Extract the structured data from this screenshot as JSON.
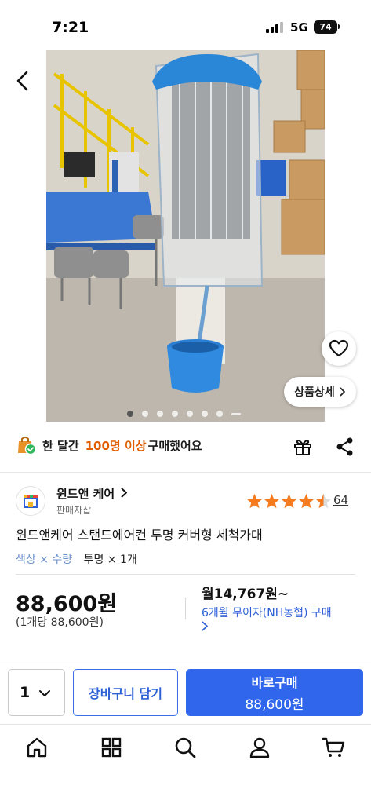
{
  "status": {
    "time": "7:21",
    "network": "5G",
    "battery": "74"
  },
  "photo": {
    "detail_label": "상품상세",
    "dot_count": 7,
    "active_dot": 0
  },
  "purchase_stat": {
    "prefix": "한 달간",
    "highlight": "100명 이상",
    "suffix": "구매했어요"
  },
  "seller": {
    "name": "윈드앤 케어",
    "type": "판매자삽",
    "rating": 4.5,
    "review_count": "64"
  },
  "product": {
    "title": "윈드앤케어 스탠드에어컨 투명 커버형 세척가대",
    "option_label": "색상 × 수량",
    "option_value": "투명 × 1개"
  },
  "price": {
    "total": "88,600원",
    "unit": "(1개당 88,600원)",
    "monthly": "월14,767원~",
    "installment": "6개월 무이자(NH농협) 구매"
  },
  "purchase_bar": {
    "quantity": "1",
    "cart_label": "장바구니 담기",
    "buy_label": "바로구매",
    "buy_price": "88,600원"
  },
  "tabs": [
    "home",
    "category",
    "search",
    "my-page",
    "cart"
  ],
  "colors": {
    "accent": "#2f66eb",
    "highlight": "#e25f00",
    "star": "#f47b20",
    "option_label": "#6b8fc9"
  }
}
